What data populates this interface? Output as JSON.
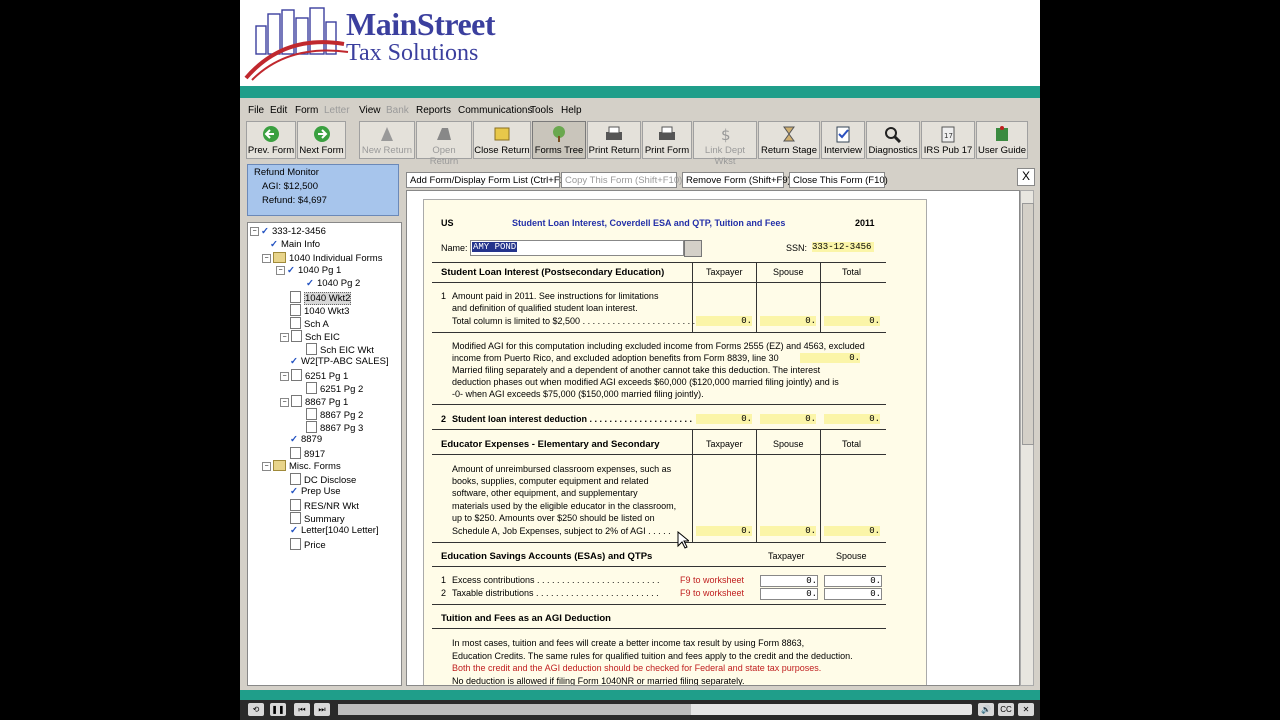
{
  "logo": {
    "main": "MainStreet",
    "sub": "Tax Solutions"
  },
  "menu": [
    "File",
    "Edit",
    "Form",
    "Letter",
    "View",
    "Bank",
    "Reports",
    "Communications",
    "Tools",
    "Help"
  ],
  "toolbar": [
    "Prev. Form",
    "Next Form",
    "New Return",
    "Open Return",
    "Close Return",
    "Forms Tree",
    "Print Return",
    "Print Form",
    "Link Dept Wkst",
    "Return Stage",
    "Interview",
    "Diagnostics",
    "IRS Pub 17",
    "User Guide"
  ],
  "refund_monitor": {
    "title": "Refund Monitor",
    "agi": "AGI: $12,500",
    "refund": "Refund: $4,697"
  },
  "tree": [
    "333-12-3456",
    "Main Info",
    "1040 Individual Forms",
    "1040 Pg 1",
    "1040 Pg 2",
    "1040 Wkt2",
    "1040 Wkt3",
    "Sch A",
    "Sch EIC",
    "Sch EIC Wkt",
    "W2[TP-ABC SALES]",
    "6251 Pg 1",
    "6251 Pg 2",
    "8867 Pg 1",
    "8867 Pg 2",
    "8867 Pg 3",
    "8879",
    "8917",
    "Misc. Forms",
    "DC Disclose",
    "Prep Use",
    "RES/NR Wkt",
    "Summary",
    "Letter[1040 Letter]",
    "Price"
  ],
  "tabs": [
    "Add Form/Display Form List (Ctrl+F10)",
    "Copy This Form (Shift+F10)",
    "Remove Form (Shift+F9)",
    "Close This Form (F10)"
  ],
  "close_label": "X",
  "form": {
    "country": "US",
    "title": "Student Loan Interest,  Coverdell ESA and QTP,  Tuition and Fees",
    "year": "2011",
    "name_label": "Name:",
    "name_value": "AMY POND",
    "ssn_label": "SSN:",
    "ssn_value": "333-12-3456",
    "sec1": "Student Loan Interest  (Postsecondary Education)",
    "col_tp": "Taxpayer",
    "col_sp": "Spouse",
    "col_tot": "Total",
    "l1_num": "1",
    "l1a": "Amount paid in 2011.  See instructions for limitations",
    "l1b": "and definition of qualified student loan interest.",
    "l1c": "Total column is limited to $2,500  . . . . . . . . . . . . . . . . . . . . . . . .",
    "zero": "0.",
    "magi1": "Modified AGI for this computation including excluded income from Forms 2555 (EZ) and 4563,  excluded",
    "magi2": "income from Puerto Rico,  and excluded adoption benefits from Form 8839,  line 30",
    "magi3": "Married filing separately and a dependent of another cannot take this deduction.  The interest",
    "magi4": "deduction phases out when modified AGI exceeds $60,000  ($120,000 married filing jointly)  and is",
    "magi5": "-0- when AGI exceeds $75,000  ($150,000 married filing jointly).",
    "l2_num": "2",
    "l2": "Student loan interest deduction  . . . . . . . . . . . . . . . . . . . . .",
    "sec2": "Educator Expenses - Elementary and Secondary",
    "edu": [
      "Amount of unreimbursed classroom expenses,  such as",
      "books,  supplies,  computer equipment and related",
      "software,  other equipment,  and supplementary",
      "materials used by the eligible educator in the classroom,",
      "up to $250.  Amounts over $250 should be listed on",
      "Schedule A,  Job Expenses,  subject to 2% of AGI  . . . . ."
    ],
    "sec3": "Education Savings Accounts  (ESAs)  and QTPs",
    "l3a_num": "1",
    "l3a": "Excess contributions  . . . . . . . . . . . . . . . . . . . . . . . . .",
    "l3b_num": "2",
    "l3b": "Taxable distributions  . . . . . . . . . . . . . . . . . . . . . . . . .",
    "f9": "F9  to worksheet",
    "sec4": "Tuition and Fees as an AGI Deduction",
    "tf1": "In most cases,  tuition and fees will create a better income tax result by using Form 8863,",
    "tf2": "Education Credits.  The same rules for qualified tuition and fees apply to the credit and the deduction.",
    "tf3": "Both the credit and the AGI deduction should be checked for Federal and state tax purposes.",
    "tf4": "No deduction is allowed if filing Form 1040NR or married filing separately."
  },
  "player": {
    "progress": 0.557
  }
}
